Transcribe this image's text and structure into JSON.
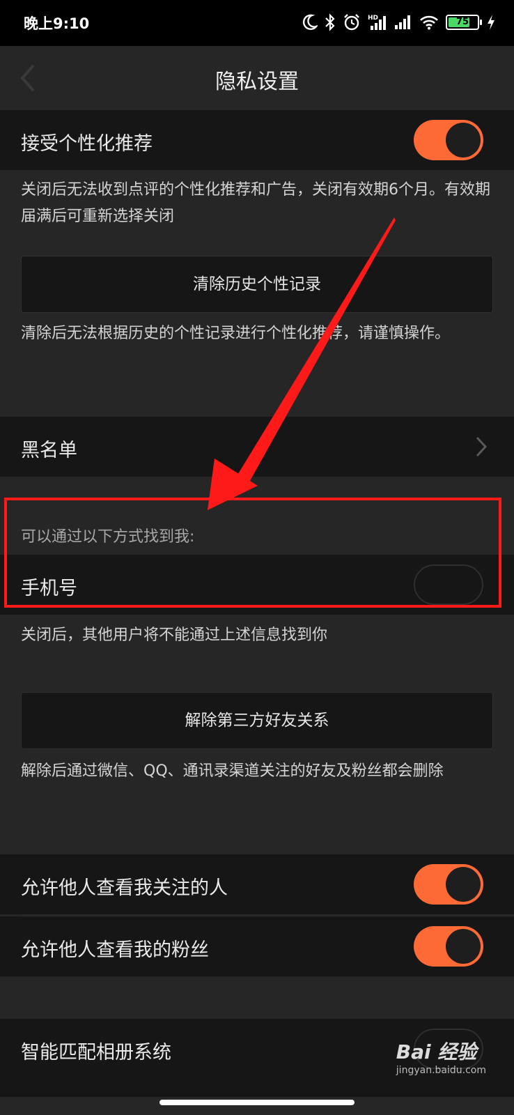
{
  "status_bar": {
    "time": "晚上9:10",
    "battery": "75",
    "icons": [
      "moon-icon",
      "bluetooth-icon",
      "alarm-icon",
      "hd-signal-icon",
      "signal-icon",
      "wifi-icon",
      "battery-icon",
      "charging-icon"
    ]
  },
  "header": {
    "title": "隐私设置",
    "back_icon": "chevron-left-icon"
  },
  "personalized": {
    "label": "接受个性化推荐",
    "enabled": true,
    "note": "关闭后无法收到点评的个性化推荐和广告，关闭有效期6个月。有效期届满后可重新选择关闭"
  },
  "clear_history": {
    "button_label": "清除历史个性记录",
    "note": "清除后无法根据历史的个性记录进行个性化推荐，请谨慎操作。"
  },
  "blacklist": {
    "label": "黑名单",
    "icon": "chevron-right-icon"
  },
  "find_me": {
    "section_label": "可以通过以下方式找到我:",
    "phone_label": "手机号",
    "phone_enabled": false,
    "note": "关闭后，其他用户将不能通过上述信息找到你"
  },
  "third_party": {
    "button_label": "解除第三方好友关系",
    "note": "解除后通过微信、QQ、通讯录渠道关注的好友及粉丝都会删除"
  },
  "visibility": {
    "following_label": "允许他人查看我关注的人",
    "following_enabled": true,
    "fans_label": "允许他人查看我的粉丝",
    "fans_enabled": true
  },
  "album": {
    "label": "智能匹配相册系统",
    "enabled": false
  },
  "watermark": {
    "text": "Bai 经验",
    "sub": "jingyan.baidu.com"
  },
  "colors": {
    "accent": "#fe6a36",
    "annotation": "#ff1a1a"
  }
}
